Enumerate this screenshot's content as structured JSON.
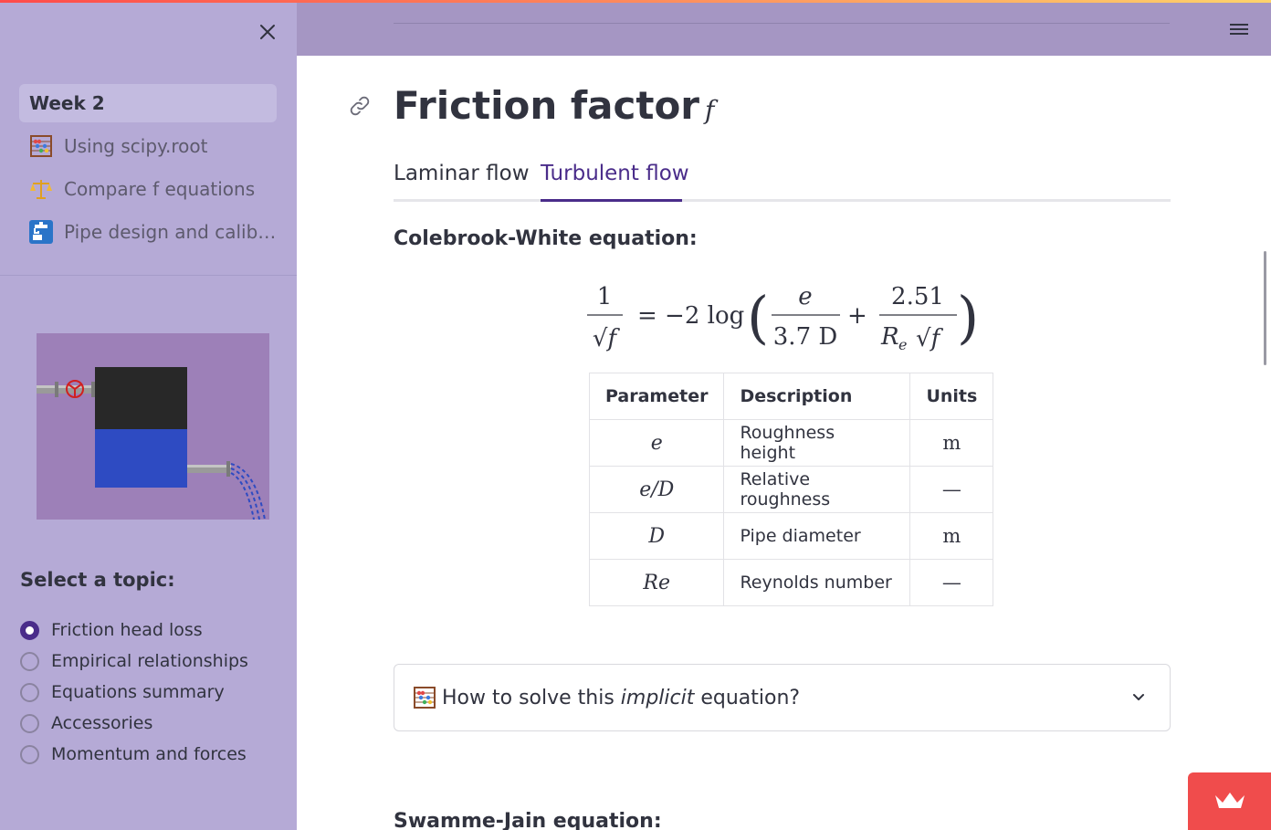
{
  "sidebar": {
    "nav_items": [
      {
        "label": "Week 2",
        "icon": "none",
        "active": true
      },
      {
        "label": "Using scipy.root",
        "icon": "abacus-icon",
        "active": false
      },
      {
        "label": "Compare f equations",
        "icon": "scales-icon",
        "active": false
      },
      {
        "label": "Pipe design and calibr…",
        "icon": "faucet-icon",
        "active": false
      }
    ],
    "topic_heading": "Select a topic:",
    "topics": [
      {
        "label": "Friction head loss",
        "checked": true
      },
      {
        "label": "Empirical relationships",
        "checked": false
      },
      {
        "label": "Equations summary",
        "checked": false
      },
      {
        "label": "Accessories",
        "checked": false
      },
      {
        "label": "Momentum and forces",
        "checked": false
      }
    ]
  },
  "main": {
    "title": "Friction factor",
    "title_symbol": "f",
    "tabs": [
      {
        "label": "Laminar flow",
        "active": false
      },
      {
        "label": "Turbulent flow",
        "active": true
      }
    ],
    "section_heading": "Colebrook-White equation:",
    "equation": {
      "lhs_numerator": "1",
      "lhs_denominator": "√f",
      "coefficient": "= −2 log",
      "term1_numerator": "e",
      "term1_denominator": "3.7 D",
      "plus": "+",
      "term2_numerator": "2.51",
      "term2_denominator_base": "R",
      "term2_denominator_sub": "e",
      "term2_denominator_root": "√f"
    },
    "table": {
      "headers": [
        "Parameter",
        "Description",
        "Units"
      ],
      "rows": [
        {
          "param": "e",
          "description": "Roughness height",
          "units": "m"
        },
        {
          "param": "e/D",
          "description": "Relative roughness",
          "units": "—"
        },
        {
          "param": "D",
          "description": "Pipe diameter",
          "units": "m"
        },
        {
          "param": "Re",
          "description": "Reynolds number",
          "units": "—"
        }
      ]
    },
    "expander": {
      "text_before": "How to solve this ",
      "text_emphasis": "implicit",
      "text_after": " equation?"
    },
    "next_heading": "Swamme-Jain equation:"
  },
  "colors": {
    "sidebar_bg": "#b5aad6",
    "header_bg": "#a596c3",
    "accent": "#4a2c8a",
    "badge": "#f04c4c"
  }
}
